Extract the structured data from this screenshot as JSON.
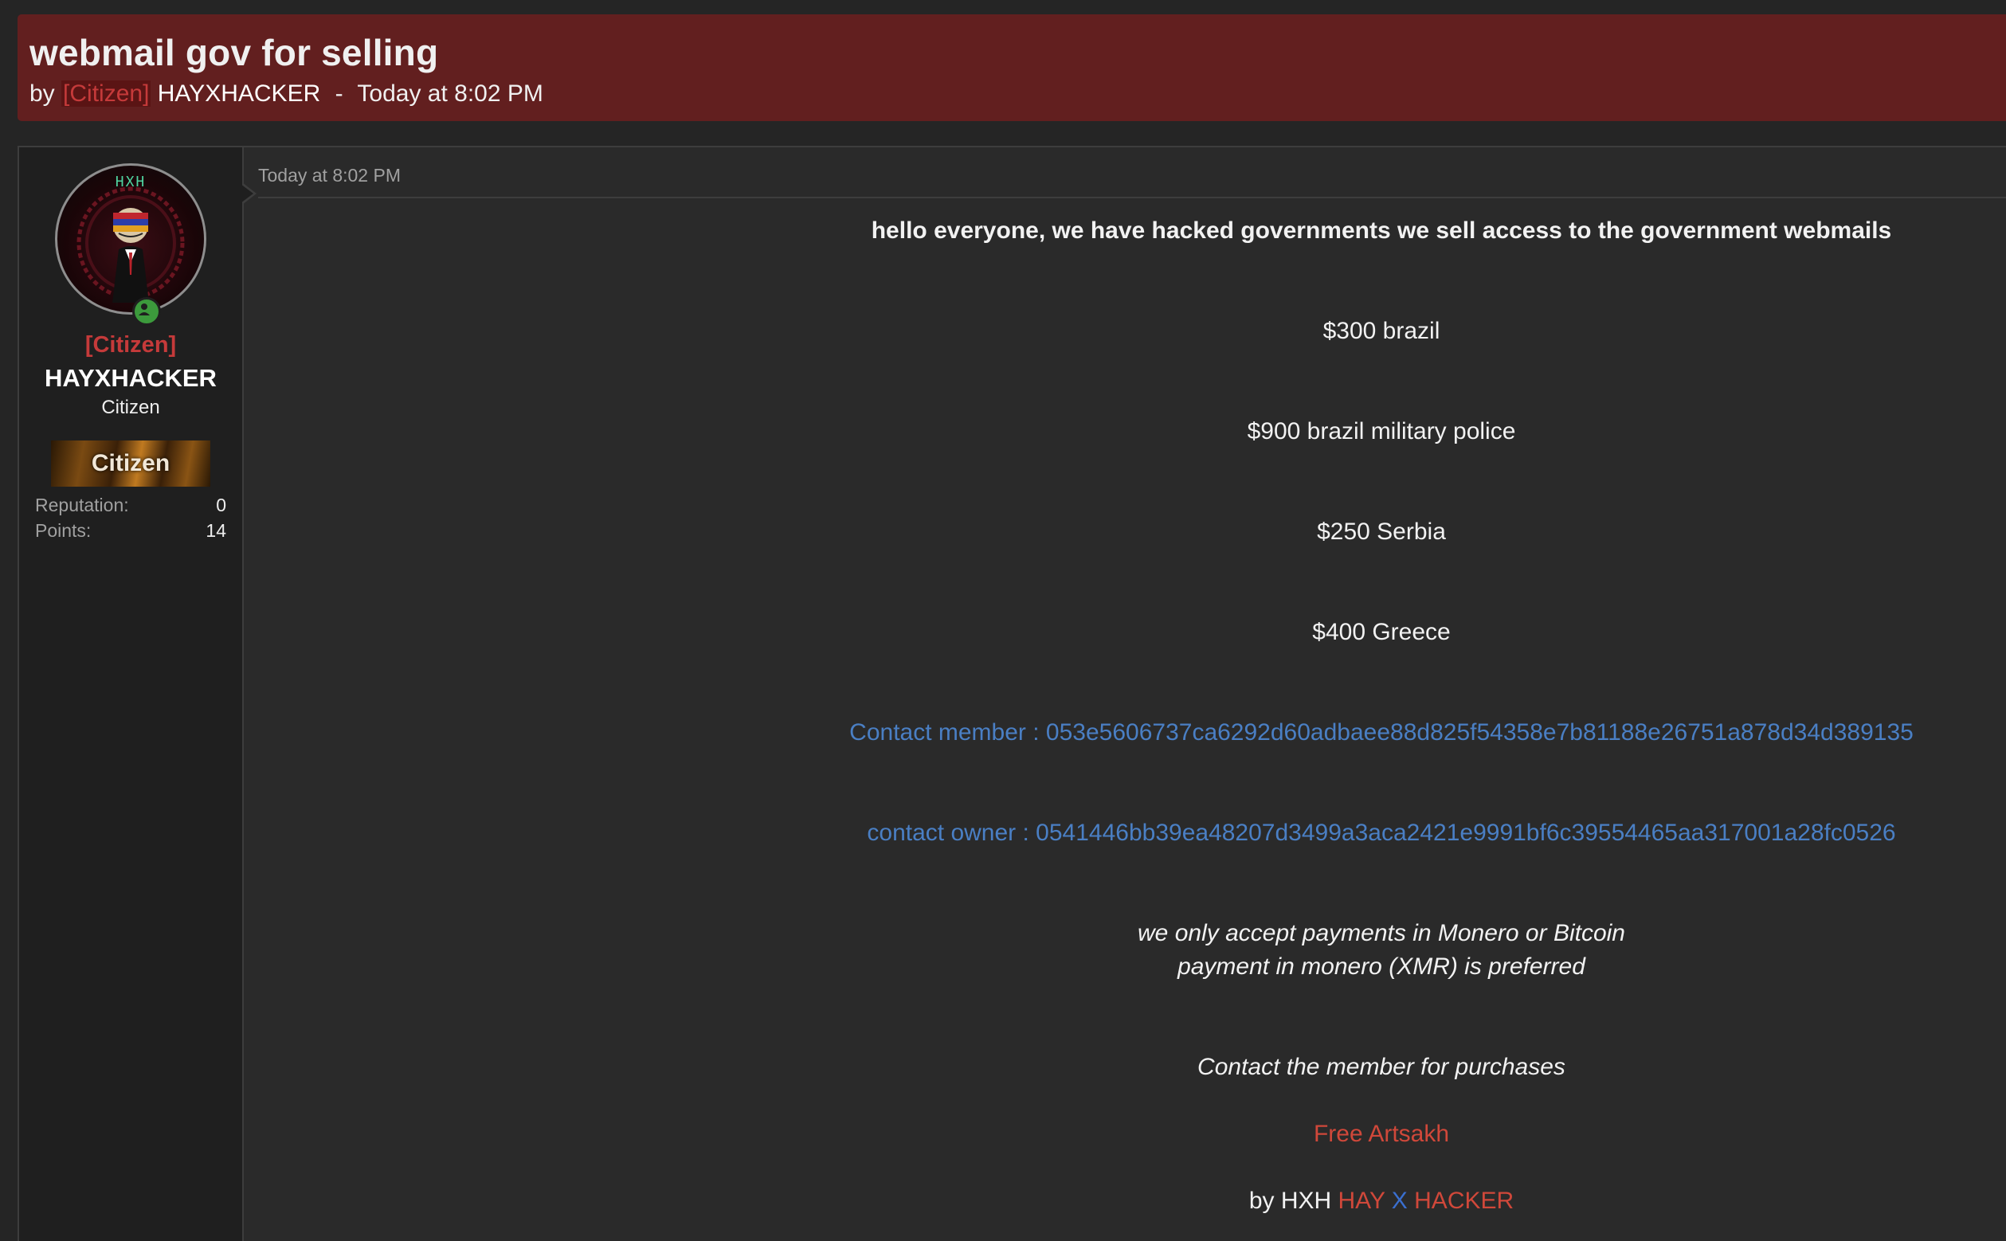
{
  "thread": {
    "title": "webmail gov for selling",
    "by_prefix": "by",
    "rank_tag": "[Citizen]",
    "author": "HAYXHACKER",
    "separator": "-",
    "timestamp": "Today at 8:02 PM"
  },
  "user": {
    "avatar_text": "HXH",
    "rank_tag": "[Citizen]",
    "name": "HAYXHACKER",
    "title": "Citizen",
    "banner": "Citizen",
    "stats": [
      {
        "label": "Reputation:",
        "value": "0"
      },
      {
        "label": "Points:",
        "value": "14"
      }
    ]
  },
  "post": {
    "date": "Today at 8:02 PM",
    "intro": "hello everyone, we have hacked governments we sell access to the government webmails",
    "prices": [
      "$300 brazil",
      "$900 brazil military police",
      "$250 Serbia",
      "$400 Greece"
    ],
    "contact_member": "Contact member : 053e5606737ca6292d60adbaee88d825f54358e7b81188e26751a878d34d389135",
    "contact_owner": "contact owner : 0541446bb39ea48207d3499a3aca2421e9991bf6c39554465aa317001a28fc0526",
    "payment_line1": "we only accept payments in Monero or Bitcoin",
    "payment_line2": "payment in monero (XMR) is preferred",
    "purchase_note": "Contact the member for purchases",
    "slogan": "Free Artsakh",
    "signature_prefix": "by HXH",
    "signature_hay": "HAY",
    "signature_x": "X",
    "signature_hacker": "HACKER"
  },
  "colors": {
    "header_bg": "#621f1f",
    "rank_red": "#c53a3a",
    "link_blue": "#4a7fc4",
    "online_green": "#3c9a3c"
  }
}
